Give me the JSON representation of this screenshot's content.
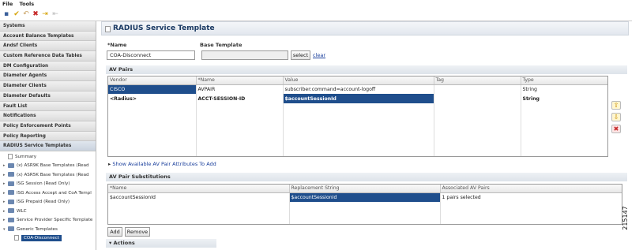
{
  "menubar": {
    "file": "File",
    "tools": "Tools"
  },
  "toolbar": {
    "icons": [
      "save-icon",
      "check-icon",
      "undo-icon",
      "delete-icon",
      "apply-icon",
      "revert-icon"
    ]
  },
  "sidebar": {
    "sections": [
      "Systems",
      "Account Balance Templates",
      "Andsf Clients",
      "Custom Reference Data Tables",
      "DM Configuration",
      "Diameter Agents",
      "Diameter Clients",
      "Diameter Defaults",
      "Fault List",
      "Notifications",
      "Policy Enforcement Points",
      "Policy Reporting",
      "RADIUS Service Templates"
    ],
    "tree": [
      {
        "label": "Summary",
        "kind": "doc"
      },
      {
        "label": "(x) ASR9K Base Templates (Read",
        "kind": "folder"
      },
      {
        "label": "(x) ASR5K Base Templates (Read",
        "kind": "folder"
      },
      {
        "label": "ISG Session (Read Only)",
        "kind": "folder"
      },
      {
        "label": "ISG Access Accept and CoA Templ",
        "kind": "folder"
      },
      {
        "label": "ISG Prepaid (Read Only)",
        "kind": "folder"
      },
      {
        "label": "WLC",
        "kind": "folder"
      },
      {
        "label": "Service Provider Specific Template",
        "kind": "folder"
      },
      {
        "label": "Generic Templates",
        "kind": "folder-open"
      },
      {
        "label": "COA-Disconnect",
        "kind": "doc-selected"
      }
    ]
  },
  "main": {
    "title": "RADIUS Service Template",
    "name_label": "*Name",
    "name_value": "COA-Disconnect",
    "base_template_label": "Base Template",
    "base_template_value": "",
    "select_button": "select",
    "clear_link": "clear",
    "av_pairs_header": "AV Pairs",
    "av_columns": [
      "Vendor",
      "*Name",
      "Value",
      "Tag",
      "Type"
    ],
    "av_rows": [
      {
        "vendor": "CISCO",
        "name": "AVPAIR",
        "value": "subscriber:command=account-logoff",
        "tag": "",
        "type": "String"
      },
      {
        "vendor": "<Radius>",
        "name": "ACCT-SESSION-ID",
        "value": "$accountSessionId",
        "tag": "",
        "type": "String"
      }
    ],
    "show_available_link": "Show Available AV Pair Attributes To Add",
    "subs_header": "AV Pair Substitutions",
    "subs_columns": [
      "*Name",
      "Replacement String",
      "Associated AV Pairs"
    ],
    "subs_rows": [
      {
        "name": "$accountSessionId",
        "replacement": "$accountSessionId",
        "associated": "1 pairs selected"
      }
    ],
    "add_button": "Add",
    "remove_button": "Remove",
    "actions_header": "Actions"
  },
  "figure_id": "215147",
  "colors": {
    "selection": "#1f4e8c",
    "link": "#1a3f9c",
    "title": "#1b3a63"
  }
}
